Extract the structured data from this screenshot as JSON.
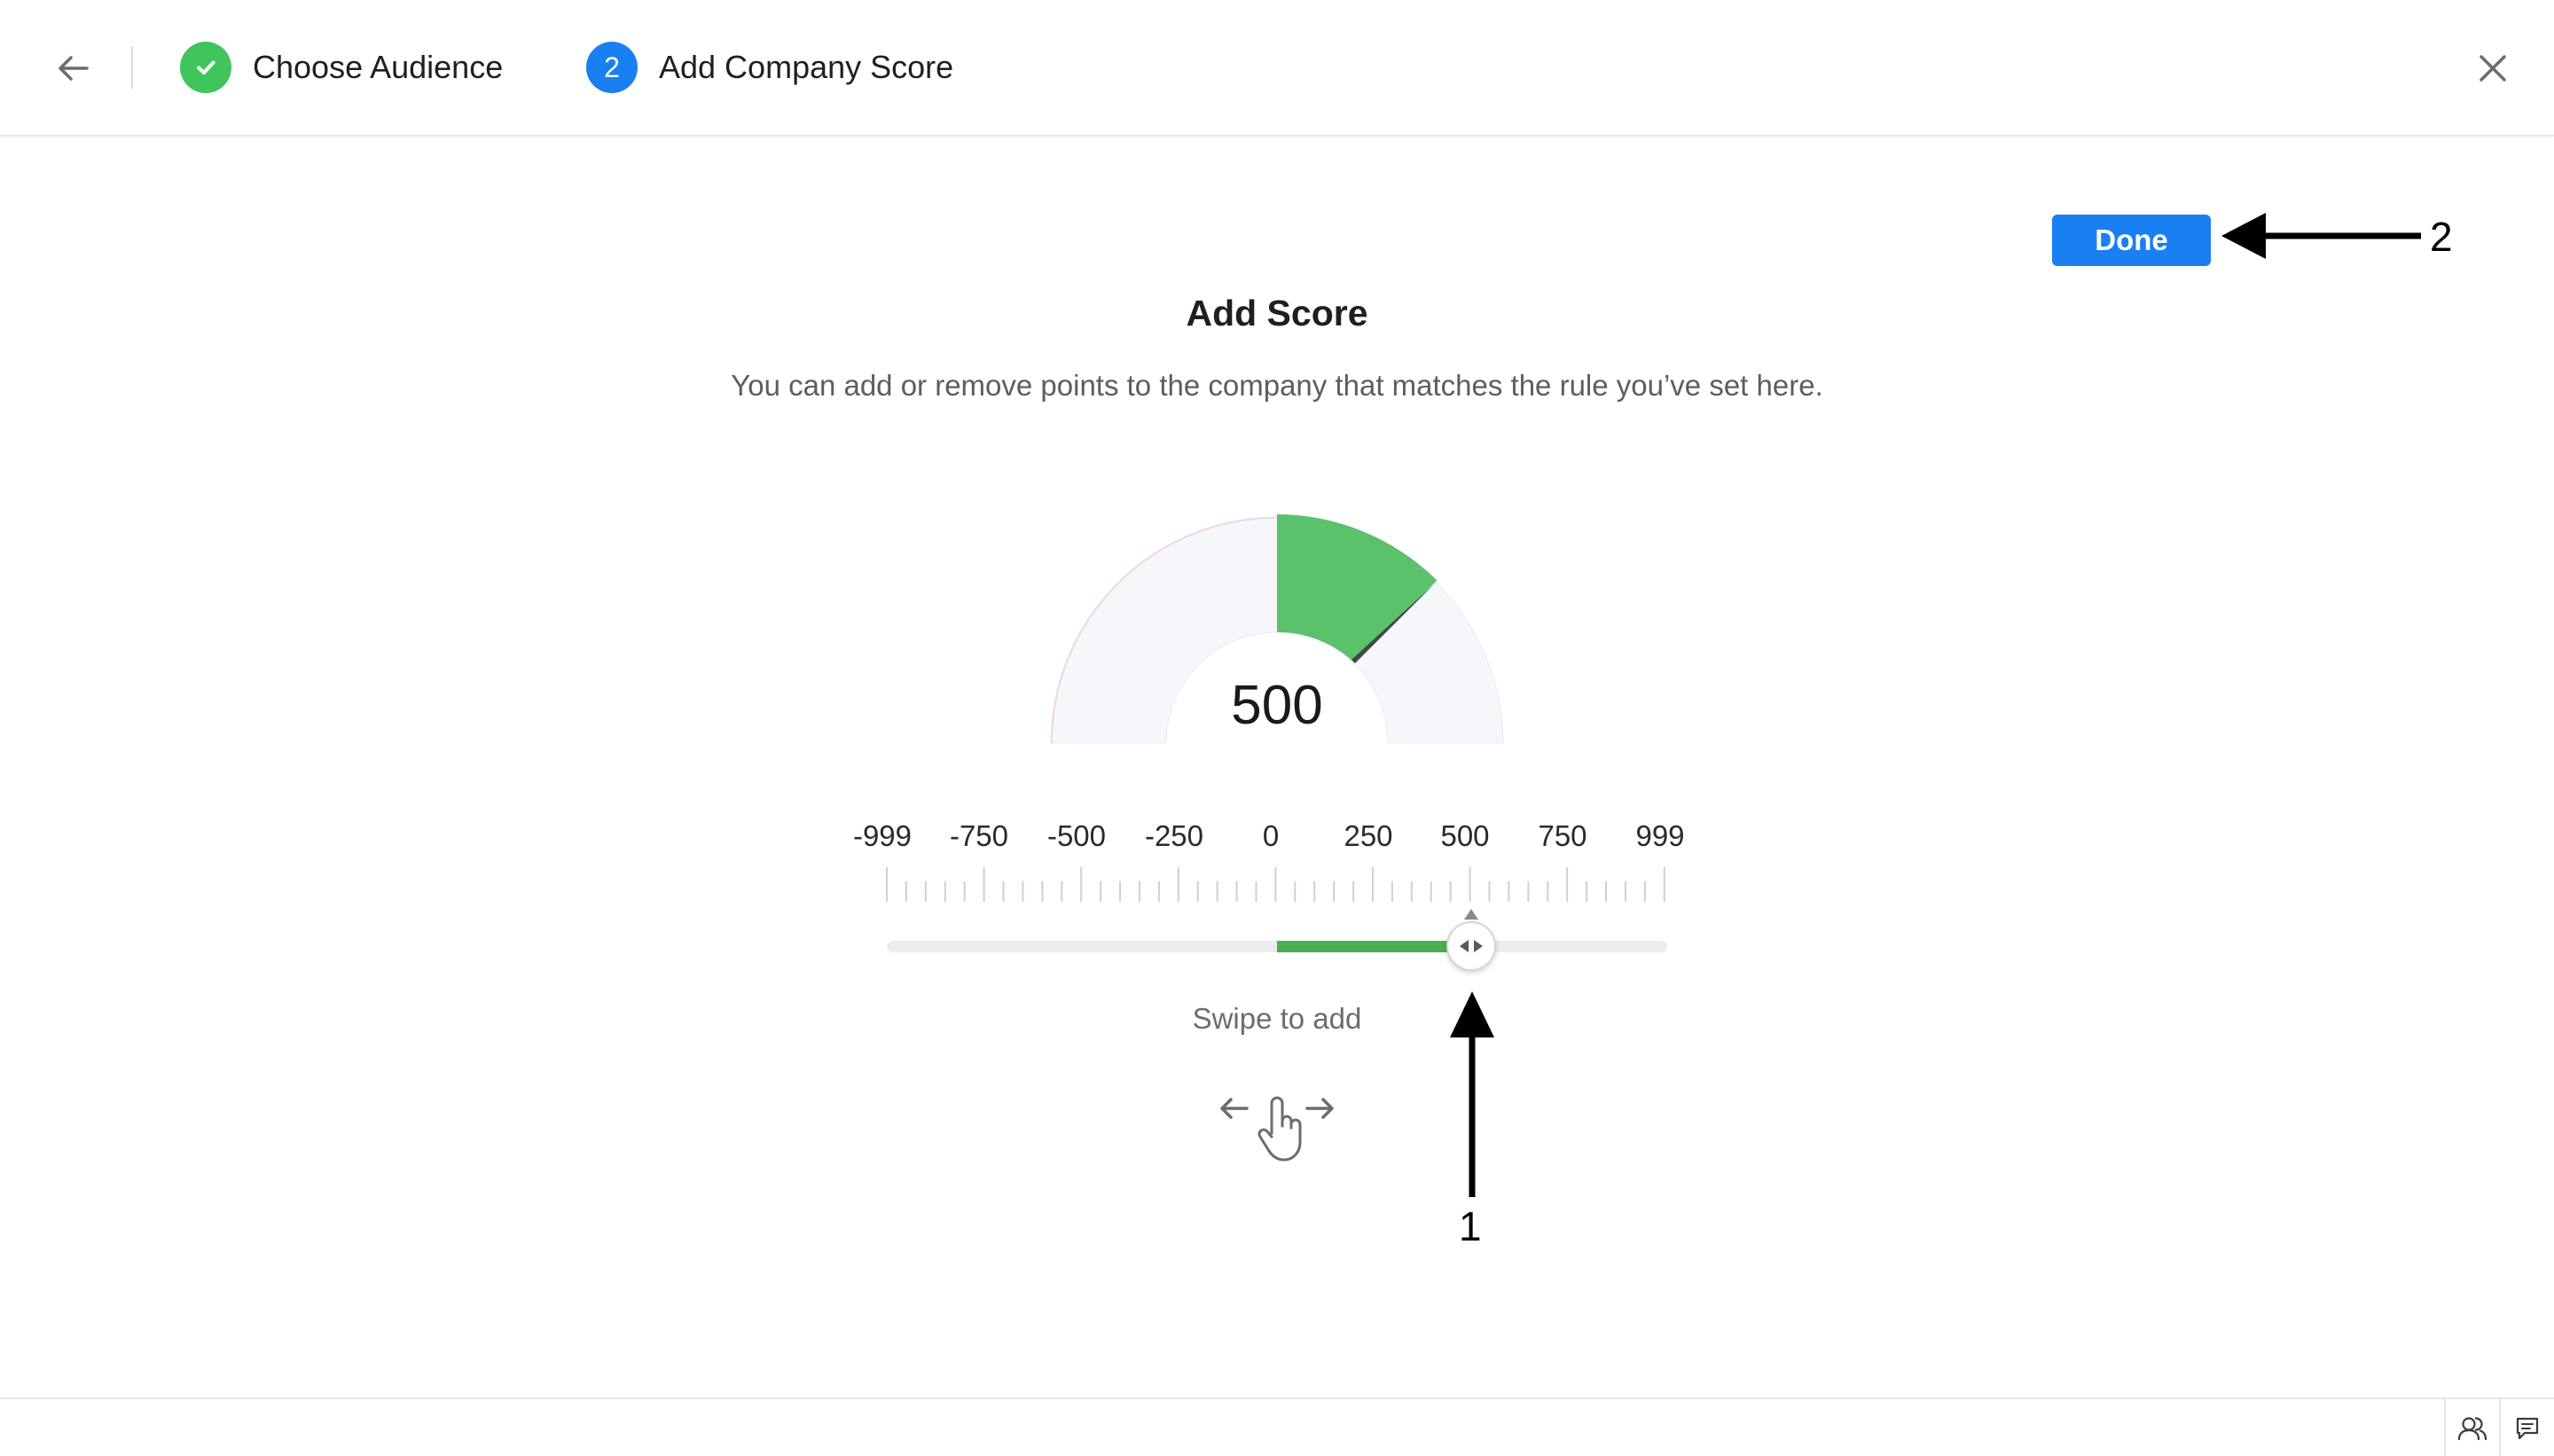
{
  "header": {
    "steps": [
      {
        "number": "",
        "label": "Choose Audience",
        "status": "completed"
      },
      {
        "number": "2",
        "label": "Add Company Score",
        "status": "active"
      }
    ]
  },
  "main": {
    "done_label": "Done",
    "title": "Add Score",
    "subtitle": "You can add or remove points to the company that matches the rule you’ve set here.",
    "gauge": {
      "value": "500"
    },
    "scale": {
      "labels": [
        "-999",
        "-750",
        "-500",
        "-250",
        "0",
        "250",
        "500",
        "750",
        "999"
      ],
      "min": -999,
      "max": 999
    },
    "slider": {
      "value": 500
    },
    "swipe_hint": "Swipe to add",
    "annotations": [
      "1",
      "2"
    ]
  },
  "colors": {
    "accent": "#1a7ff0",
    "success": "#3fc55b",
    "gauge_fill": "#5cc16b",
    "slider_fill": "#4caf50"
  },
  "icons": {
    "back": "arrow-left-icon",
    "check": "check-icon",
    "close": "close-icon",
    "thumb": "left-right-arrows-icon",
    "swipe": "swipe-hand-icon",
    "footer": [
      "people-icon",
      "chat-icon"
    ]
  }
}
